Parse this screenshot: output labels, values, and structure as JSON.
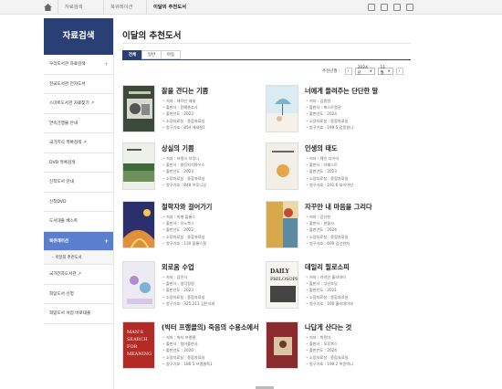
{
  "breadcrumb": [
    "자료검색",
    "북큐레이션",
    "이달의 추천도서"
  ],
  "sidebar": {
    "heading": "자료검색",
    "items": [
      {
        "label": "우리도서관 자료검색",
        "has_plus": true
      },
      {
        "label": "전국도서관 전자도서",
        "has_plus": false
      },
      {
        "label": "스마트도서관 자료찾기 ↗",
        "has_plus": false
      },
      {
        "label": "연속간행물 안내",
        "has_plus": false
      },
      {
        "label": "국가지식 목록검색 ↗",
        "has_plus": false
      },
      {
        "label": "DVD 목록검색",
        "has_plus": false
      },
      {
        "label": "신착도서 안내",
        "has_plus": false
      },
      {
        "label": "신착DVD",
        "has_plus": false
      },
      {
        "label": "도서대출 베스트",
        "has_plus": false
      },
      {
        "label": "북큐레이션",
        "has_plus": true,
        "active": true
      }
    ],
    "sub_items": [
      "이달의 추천도서",
      "북큐레이션"
    ],
    "items_after": [
      {
        "label": "국가전자도서관 ↗",
        "has_plus": false
      },
      {
        "label": "희망도서 신청",
        "has_plus": false
      },
      {
        "label": "희망도서 서점 바로대출",
        "has_plus": false
      }
    ]
  },
  "page_title": "이달의 추천도서",
  "tabs": [
    "전체",
    "일반",
    "아동"
  ],
  "period": {
    "label": "추천년월 :",
    "year": "2024년",
    "month": "11월"
  },
  "books": [
    {
      "title": "잘을 견디는 기쁨",
      "meta": [
        "저자 : 헤르만 헤세",
        "출판사 : 문예춘추사",
        "출판년도 : 2023",
        "소장자료실 : 종합자료실",
        "청구기호 : 854 헤세잘1"
      ]
    },
    {
      "title": "너에게 들려주는 단단한 말",
      "meta": [
        "저자 : 김종원",
        "출판사 : 퍼스트펭귄",
        "출판년도 : 2024",
        "소장자료실 : 종합자료실",
        "청구기호 : 199.5 김종원너"
      ]
    },
    {
      "title": "상실의 기쁨",
      "meta": [
        "저자 : 프랭크 브루니",
        "출판사 : 웅진지식하우스",
        "출판년도 : 2023",
        "소장자료실 : 종합자료실",
        "청구기호 : 848 브루니상"
      ]
    },
    {
      "title": "인생의 태도",
      "meta": [
        "저자 : 웨인 다이어",
        "출판사 : 더퀘스트",
        "출판년도 : 2023",
        "소장자료실 : 종합자료실",
        "청구기호 : 191.6 다이어인"
      ]
    },
    {
      "title": "철학자와 걸어가기",
      "meta": [
        "저자 : 미셸 플롱스",
        "출판사 : 유노북스",
        "출판년도 : 2022",
        "소장자료실 : 종합자료실",
        "청구기호 : 130 플롱스철"
      ]
    },
    {
      "title": "자꾸만 내 마음을 그리다",
      "meta": [
        "저자 : 김선현",
        "출판사 : 한울사",
        "출판년도 : 2024",
        "소장자료실 : 종합자료실",
        "청구기호 : 609 김선현자"
      ]
    },
    {
      "title": "외로움 수업",
      "meta": [
        "저자 : 김민식",
        "출판사 : 생각정원",
        "출판년도 : 2023",
        "소장자료실 : 종합자료실",
        "청구기호 : 325.211 김민식외"
      ]
    },
    {
      "title": "데일리 필로소피",
      "meta": [
        "저자 : 라이언 홀리데이",
        "출판사 : 다산초당",
        "출판년도 : 2021",
        "소장자료실 : 종합자료실",
        "청구기호 : 100 홀리데이데"
      ]
    },
    {
      "title": "(빅터 프랭클의) 죽음의 수용소에서",
      "meta": [
        "저자 : 빅터 프랭클",
        "출판사 : 청아출판사",
        "출판년도 : 2020",
        "소장자료실 : 종합자료실",
        "청구기호 : 186.5 프랭클죽1"
      ]
    },
    {
      "title": "나답게 산다는 것",
      "meta": [
        "저자 : 박윤미",
        "출판사 : 모루북스",
        "출판년도 : 2024",
        "소장자료실 : 종합자료실",
        "청구기호 : 199.2 박윤미나"
      ]
    }
  ],
  "colors": {
    "primary": "#2a3f73",
    "active": "#5a7fcf"
  }
}
